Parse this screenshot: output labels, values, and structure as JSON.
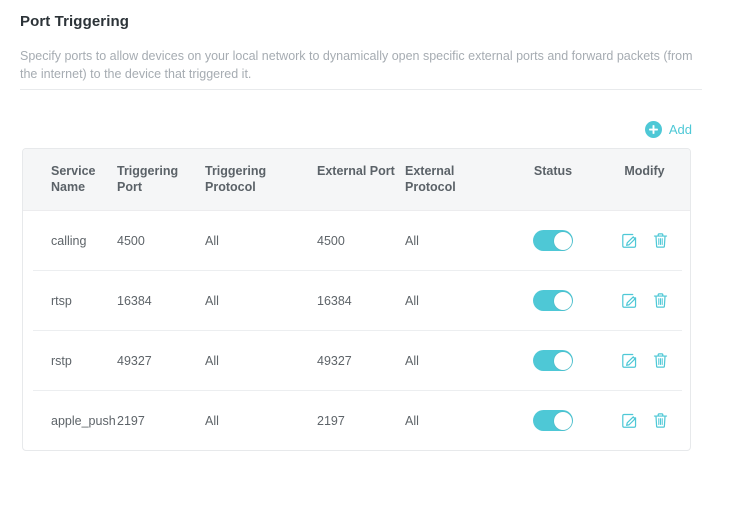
{
  "page": {
    "title": "Port Triggering",
    "description": "Specify ports to allow devices on your local network to dynamically open specific external ports and forward packets (from the internet) to the device that triggered it."
  },
  "toolbar": {
    "add_label": "Add",
    "add_icon": "plus-circle-icon"
  },
  "colors": {
    "accent": "#4ec8d6",
    "title_text": "#2c3338",
    "description_text": "#a6acb2",
    "header_bg": "#f5f6f7",
    "header_text": "#5b6268",
    "cell_text": "#5e6469",
    "border": "#e7e9eb",
    "toggle_on": "#4ec8d6"
  },
  "table": {
    "columns": [
      {
        "label": "Service Name",
        "align": "left"
      },
      {
        "label": "Triggering Port",
        "align": "left"
      },
      {
        "label": "Triggering Protocol",
        "align": "left"
      },
      {
        "label": "External Port",
        "align": "left"
      },
      {
        "label": "External Protocol",
        "align": "left"
      },
      {
        "label": "Status",
        "align": "center"
      },
      {
        "label": "Modify",
        "align": "center"
      }
    ],
    "rows": [
      {
        "service_name": "calling",
        "triggering_port": "4500",
        "triggering_protocol": "All",
        "external_port": "4500",
        "external_protocol": "All",
        "status": "on"
      },
      {
        "service_name": "rtsp",
        "triggering_port": "16384",
        "triggering_protocol": "All",
        "external_port": "16384",
        "external_protocol": "All",
        "status": "on"
      },
      {
        "service_name": "rstp",
        "triggering_port": "49327",
        "triggering_protocol": "All",
        "external_port": "49327",
        "external_protocol": "All",
        "status": "on"
      },
      {
        "service_name": "apple_push",
        "triggering_port": "2197",
        "triggering_protocol": "All",
        "external_port": "2197",
        "external_protocol": "All",
        "status": "on"
      }
    ],
    "modify_actions": [
      {
        "icon": "edit-icon",
        "name": "edit-row-button"
      },
      {
        "icon": "trash-icon",
        "name": "delete-row-button"
      }
    ]
  }
}
